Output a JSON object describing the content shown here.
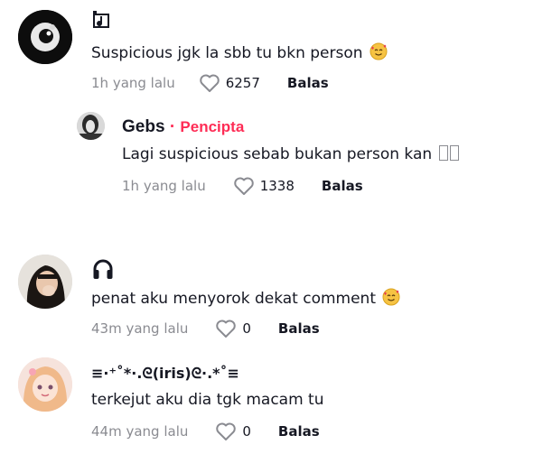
{
  "comments": [
    {
      "username": "",
      "username_icon": "music-note-icon",
      "text": "Suspicious jgk la sbb tu bkn person",
      "emoji": "smiling-face-with-hearts",
      "time": "1h yang lalu",
      "likes": "6257",
      "reply_label": "Balas",
      "reply": {
        "username": "Gebs",
        "separator": "·",
        "badge": "Pencipta",
        "text": "Lagi suspicious sebab bukan person kan",
        "time": "1h yang lalu",
        "likes": "1338",
        "reply_label": "Balas"
      }
    },
    {
      "username_icon": "headphones-icon",
      "text": "penat aku menyorok dekat comment",
      "emoji": "smiling-face-with-hearts",
      "time": "43m yang lalu",
      "likes": "0",
      "reply_label": "Balas"
    },
    {
      "username": "≡·⁺˚*·.ᘓ(iris)ᘓ·.*˚≡",
      "text": "terkejut aku dia tgk macam tu",
      "time": "44m yang lalu",
      "likes": "0",
      "reply_label": "Balas"
    }
  ],
  "colors": {
    "accent": "#fe2c55",
    "muted": "#8a8b91",
    "text": "#161823"
  }
}
